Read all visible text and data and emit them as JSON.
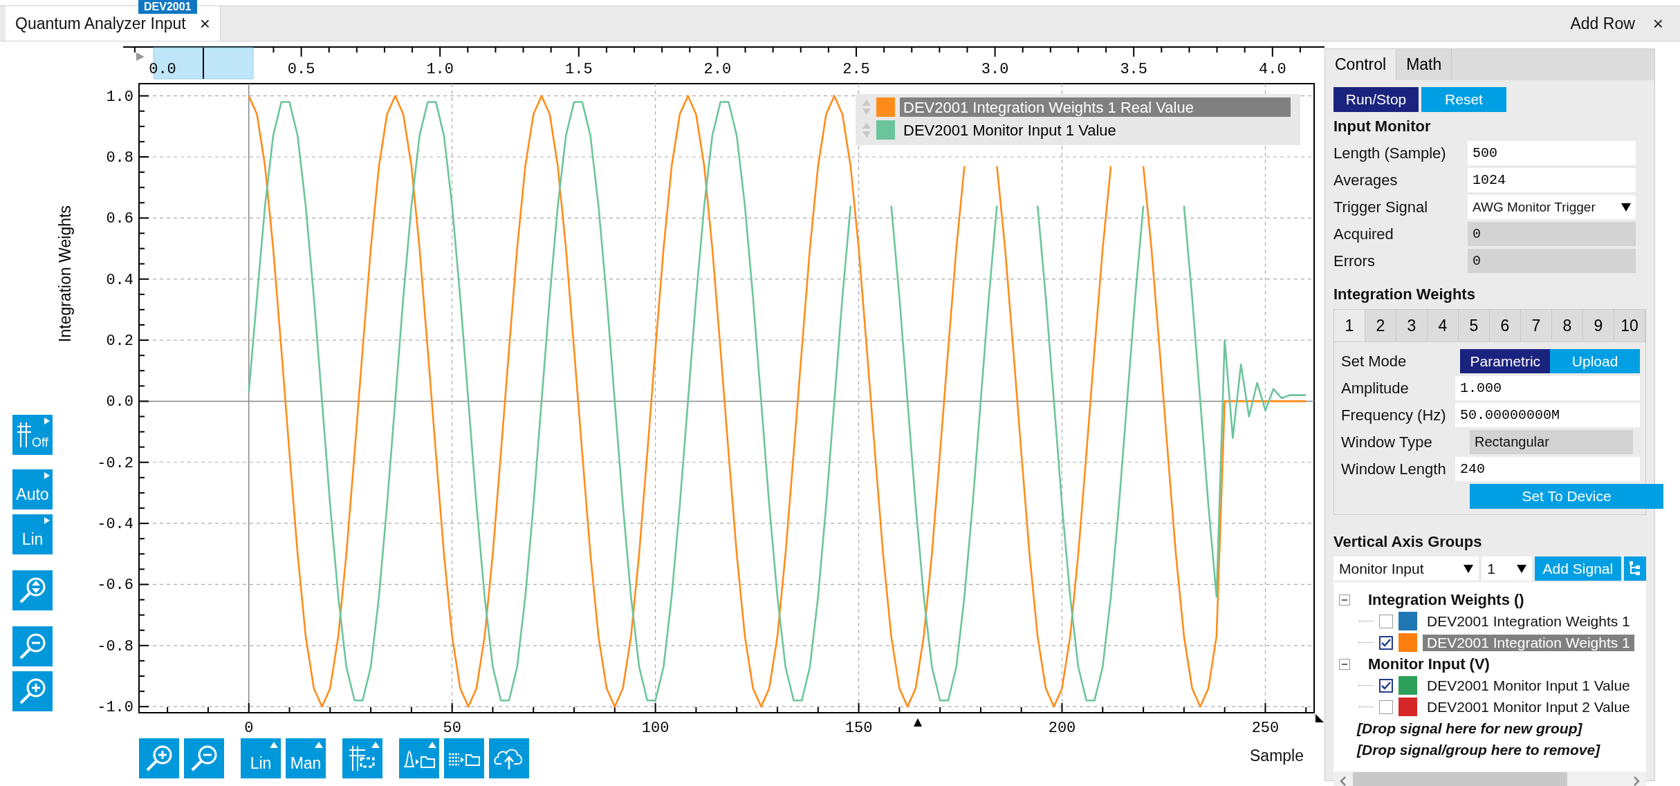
{
  "tab": {
    "title": "Quantum Analyzer Input",
    "close": "×",
    "badge": "DEV2001"
  },
  "header_actions": {
    "add_row": "Add Row",
    "close": "×"
  },
  "overview_axis": {
    "ticks": [
      "0.0",
      "0.5",
      "1.0",
      "1.5",
      "2.0",
      "2.5",
      "3.0",
      "3.5",
      "4.0"
    ]
  },
  "left_toolbar": [
    {
      "kind": "grid",
      "label": "Off"
    },
    {
      "kind": "text",
      "label": "Auto"
    },
    {
      "kind": "text",
      "label": "Lin"
    },
    {
      "kind": "zoom_fit"
    },
    {
      "kind": "zoom_out"
    },
    {
      "kind": "zoom_in"
    }
  ],
  "bottom_toolbar": [
    {
      "kind": "zoom_in"
    },
    {
      "kind": "zoom_out"
    },
    {
      "kind": "text",
      "label": "Lin"
    },
    {
      "kind": "text",
      "label": "Man"
    },
    {
      "kind": "cursor"
    },
    {
      "kind": "export_plot"
    },
    {
      "kind": "export_data"
    },
    {
      "kind": "upload"
    }
  ],
  "chart_data": {
    "type": "line",
    "grid": true,
    "legend": "upper right",
    "ylabel": "Integration Weights",
    "xlabel": "Sample",
    "xlim": [
      -27,
      262
    ],
    "ylim": [
      -1.02,
      1.04
    ],
    "xticks": [
      0,
      50,
      100,
      150,
      200,
      250
    ],
    "yticks": [
      {
        "value": -1,
        "label": "-1.0"
      },
      {
        "value": -0.8,
        "label": "-0.8"
      },
      {
        "value": -0.6,
        "label": "-0.6"
      },
      {
        "value": -0.4,
        "label": "-0.4"
      },
      {
        "value": -0.2,
        "label": "-0.2"
      },
      {
        "value": 0,
        "label": "0.0"
      },
      {
        "value": 0.2,
        "label": "0.2"
      },
      {
        "value": 0.4,
        "label": "0.4"
      },
      {
        "value": 0.6,
        "label": "0.6"
      },
      {
        "value": 0.8,
        "label": "0.8"
      },
      {
        "value": 1,
        "label": "1.0"
      }
    ],
    "x": [
      0,
      2,
      4,
      6,
      8,
      10,
      12,
      14,
      16,
      18,
      20,
      22,
      24,
      26,
      28,
      30,
      32,
      34,
      36,
      38,
      40,
      42,
      44,
      46,
      48,
      50,
      52,
      54,
      56,
      58,
      60,
      62,
      64,
      66,
      68,
      70,
      72,
      74,
      76,
      78,
      80,
      82,
      84,
      86,
      88,
      90,
      92,
      94,
      96,
      98,
      100,
      102,
      104,
      106,
      108,
      110,
      112,
      114,
      116,
      118,
      120,
      122,
      124,
      126,
      128,
      130,
      132,
      134,
      136,
      138,
      140,
      142,
      144,
      146,
      148,
      150,
      152,
      154,
      156,
      158,
      160,
      162,
      164,
      166,
      168,
      170,
      172,
      174,
      176,
      178,
      180,
      182,
      184,
      186,
      188,
      190,
      192,
      194,
      196,
      198,
      200,
      202,
      204,
      206,
      208,
      210,
      212,
      214,
      216,
      218,
      220,
      222,
      224,
      226,
      228,
      230,
      232,
      234,
      236,
      238,
      240,
      242,
      244,
      246,
      248,
      250,
      252,
      254,
      256,
      258,
      260
    ],
    "series": [
      {
        "name": "DEV2001 Integration Weights 1 Real Value",
        "color": "#ff8c1a",
        "values": [
          1,
          0.94,
          0.77,
          0.5,
          0.17,
          -0.17,
          -0.5,
          -0.77,
          -0.94,
          -1,
          -0.94,
          -0.77,
          -0.5,
          -0.17,
          0.17,
          0.5,
          0.77,
          0.94,
          1,
          0.94,
          0.77,
          0.5,
          0.17,
          -0.17,
          -0.5,
          -0.77,
          -0.94,
          -1,
          -0.94,
          -0.77,
          -0.5,
          -0.17,
          0.17,
          0.5,
          0.77,
          0.94,
          1,
          0.94,
          0.77,
          0.5,
          0.17,
          -0.17,
          -0.5,
          -0.77,
          -0.94,
          -1,
          -0.94,
          -0.77,
          -0.5,
          -0.17,
          0.17,
          0.5,
          0.77,
          0.94,
          1,
          0.94,
          0.77,
          0.5,
          0.17,
          -0.17,
          -0.5,
          -0.77,
          -0.94,
          -1,
          -0.94,
          -0.77,
          -0.5,
          -0.17,
          0.17,
          0.5,
          0.77,
          0.94,
          1,
          0.94,
          0.77,
          0.5,
          0.17,
          -0.17,
          -0.5,
          -0.77,
          -0.94,
          -1,
          -0.94,
          -0.77,
          -0.5,
          -0.17,
          0.17,
          0.5,
          0.77,
          null,
          null,
          null,
          0.77,
          0.5,
          0.17,
          -0.17,
          -0.5,
          -0.77,
          -0.94,
          -1,
          -0.94,
          -0.77,
          -0.5,
          -0.17,
          0.17,
          0.5,
          0.77,
          null,
          null,
          null,
          0.77,
          0.5,
          0.17,
          -0.17,
          -0.5,
          -0.77,
          -0.94,
          -1,
          -0.94,
          -0.77,
          0,
          0,
          0,
          0,
          0,
          0,
          0,
          0,
          0,
          0,
          0
        ]
      },
      {
        "name": "DEV2001 Monitor Input 1 Value",
        "color": "#6cc49c",
        "values": [
          0.03,
          0.34,
          0.64,
          0.87,
          0.98,
          0.98,
          0.87,
          0.64,
          0.34,
          0,
          -0.34,
          -0.64,
          -0.87,
          -0.98,
          -0.98,
          -0.87,
          -0.64,
          -0.34,
          0,
          0.34,
          0.64,
          0.87,
          0.98,
          0.98,
          0.87,
          0.64,
          0.34,
          0,
          -0.34,
          -0.64,
          -0.87,
          -0.98,
          -0.98,
          -0.87,
          -0.64,
          -0.34,
          0,
          0.34,
          0.64,
          0.87,
          0.98,
          0.98,
          0.87,
          0.64,
          0.34,
          0,
          -0.34,
          -0.64,
          -0.87,
          -0.98,
          -0.98,
          -0.87,
          -0.64,
          -0.34,
          0,
          0.34,
          0.64,
          0.87,
          0.98,
          0.98,
          0.87,
          0.64,
          0.34,
          0,
          -0.34,
          -0.64,
          -0.87,
          -0.98,
          -0.98,
          -0.87,
          -0.64,
          -0.34,
          0,
          0.34,
          0.64,
          null,
          null,
          null,
          null,
          0.64,
          0.34,
          0,
          -0.34,
          -0.64,
          -0.87,
          -0.98,
          -0.98,
          -0.87,
          -0.64,
          -0.34,
          0,
          0.34,
          0.64,
          null,
          null,
          null,
          null,
          0.64,
          0.34,
          0,
          -0.34,
          -0.64,
          -0.87,
          -0.98,
          -0.98,
          -0.87,
          -0.64,
          -0.34,
          0,
          0.34,
          0.64,
          null,
          null,
          null,
          null,
          0.64,
          0.34,
          0,
          -0.34,
          -0.64,
          0.2,
          -0.12,
          0.12,
          -0.05,
          0.06,
          -0.03,
          0.04,
          0.01,
          0.02,
          0.02,
          0.02
        ]
      }
    ]
  },
  "legend": [
    {
      "selected": true
    },
    {
      "selected": false
    }
  ],
  "panel": {
    "tabs": [
      {
        "label": "Control",
        "selected": true
      },
      {
        "label": "Math",
        "selected": false
      }
    ],
    "actions": [
      {
        "label": "Run/Stop",
        "kind": "primary"
      },
      {
        "label": "Reset",
        "kind": "secondary"
      }
    ],
    "input_monitor": {
      "title": "Input Monitor",
      "fields": [
        {
          "label": "Length (Sample)",
          "value": "500",
          "kind": "input"
        },
        {
          "label": "Averages",
          "value": "1024",
          "kind": "input"
        },
        {
          "label": "Trigger Signal",
          "value": "AWG Monitor Trigger",
          "kind": "select"
        },
        {
          "label": "Acquired",
          "value": "0",
          "kind": "readonly"
        },
        {
          "label": "Errors",
          "value": "0",
          "kind": "readonly"
        }
      ]
    },
    "integration_weights": {
      "title": "Integration Weights",
      "tabs": [
        {
          "label": "1",
          "selected": true
        },
        {
          "label": "2",
          "selected": false
        },
        {
          "label": "3",
          "selected": false
        },
        {
          "label": "4",
          "selected": false
        },
        {
          "label": "5",
          "selected": false
        },
        {
          "label": "6",
          "selected": false
        },
        {
          "label": "7",
          "selected": false
        },
        {
          "label": "8",
          "selected": false
        },
        {
          "label": "9",
          "selected": false
        },
        {
          "label": "10",
          "selected": false
        }
      ],
      "mode": {
        "label": "Set Mode",
        "options": [
          {
            "label": "Parametric",
            "selected": true
          },
          {
            "label": "Upload",
            "selected": false
          }
        ]
      },
      "fields": [
        {
          "label": "Amplitude",
          "value": "1.000",
          "kind": "input"
        },
        {
          "label": "Frequency (Hz)",
          "value": "50.00000000M",
          "kind": "input"
        },
        {
          "label": "Window Type",
          "value": "Rectangular",
          "kind": "readonly"
        },
        {
          "label": "Window Length",
          "value": "240",
          "kind": "input"
        }
      ],
      "apply": "Set To Device"
    },
    "vertical_axis_groups": {
      "title": "Vertical Axis Groups",
      "group_select": "Monitor Input",
      "index_select": "1",
      "add_button": "Add Signal",
      "tree": [
        {
          "label": "Integration Weights ()",
          "expanded": true,
          "children": [
            {
              "label": "DEV2001 Integration Weights 1",
              "checked": false,
              "color": "#1f77b4",
              "selected": false
            },
            {
              "label": "DEV2001 Integration Weights 1",
              "checked": true,
              "color": "#ff7f0e",
              "selected": true
            }
          ]
        },
        {
          "label": "Monitor Input (V)",
          "expanded": true,
          "children": [
            {
              "label": "DEV2001 Monitor Input 1 Value",
              "checked": true,
              "color": "#2ca05a",
              "selected": false
            },
            {
              "label": "DEV2001 Monitor Input 2 Value",
              "checked": false,
              "color": "#d62728",
              "selected": false
            }
          ]
        }
      ],
      "hints": [
        "[Drop signal here for new group]",
        "[Drop signal/group here to remove]"
      ]
    }
  }
}
